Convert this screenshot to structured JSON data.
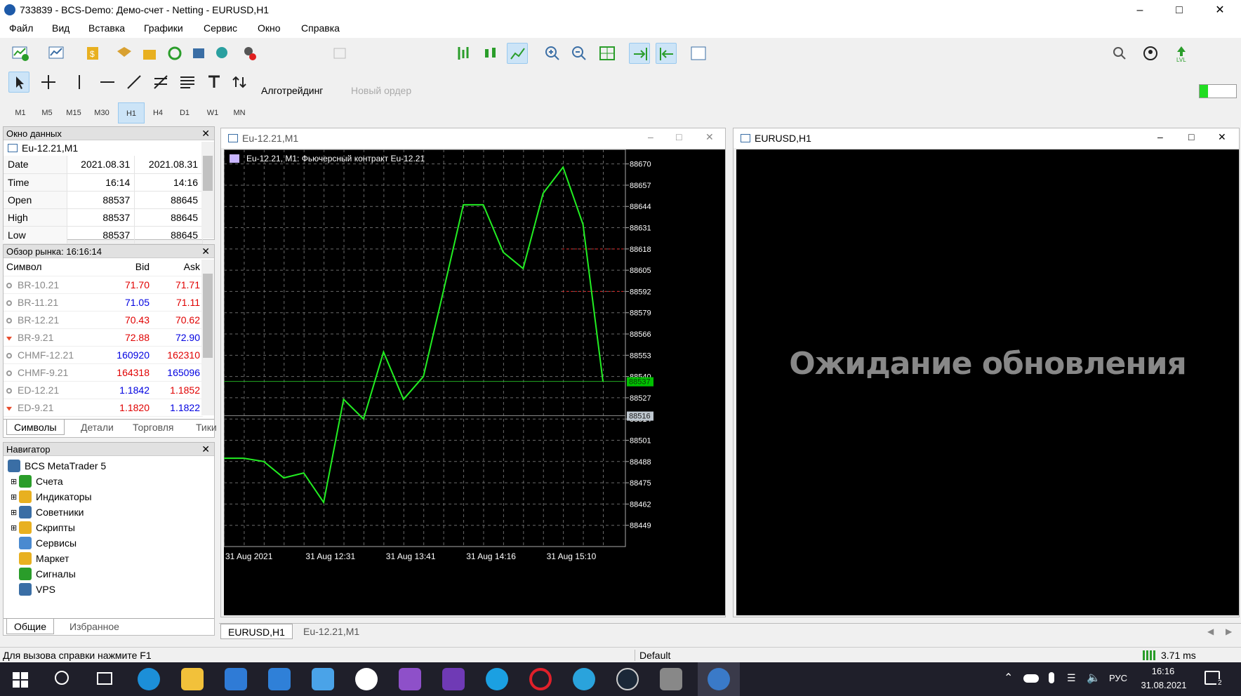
{
  "window": {
    "title": "733839 - BCS-Demo: Демо-счет - Netting - EURUSD,H1"
  },
  "menu": [
    "Файл",
    "Вид",
    "Вставка",
    "Графики",
    "Сервис",
    "Окно",
    "Справка"
  ],
  "toolbar": {
    "algo_label": "Алготрейдинг",
    "new_order_label": "Новый ордер"
  },
  "timeframes": [
    "M1",
    "M5",
    "M15",
    "M30",
    "H1",
    "H4",
    "D1",
    "W1",
    "MN"
  ],
  "timeframe_selected": "H1",
  "data_window": {
    "title": "Окно данных",
    "symbol": "Eu-12.21,M1",
    "rows": [
      {
        "label": "Date",
        "v1": "2021.08.31",
        "v2": "2021.08.31"
      },
      {
        "label": "Time",
        "v1": "16:14",
        "v2": "14:16"
      },
      {
        "label": "Open",
        "v1": "88537",
        "v2": "88645"
      },
      {
        "label": "High",
        "v1": "88537",
        "v2": "88645"
      },
      {
        "label": "Low",
        "v1": "88537",
        "v2": "88645"
      }
    ]
  },
  "market_watch": {
    "title": "Обзор рынка: 16:16:14",
    "headers": {
      "symbol": "Символ",
      "bid": "Bid",
      "ask": "Ask"
    },
    "rows": [
      {
        "symbol": "BR-10.21",
        "bid": "71.70",
        "ask": "71.71",
        "bidc": "red",
        "askc": "red",
        "ico": "dot"
      },
      {
        "symbol": "BR-11.21",
        "bid": "71.05",
        "ask": "71.11",
        "bidc": "blue",
        "askc": "red",
        "ico": "dot"
      },
      {
        "symbol": "BR-12.21",
        "bid": "70.43",
        "ask": "70.62",
        "bidc": "red",
        "askc": "red",
        "ico": "dot"
      },
      {
        "symbol": "BR-9.21",
        "bid": "72.88",
        "ask": "72.90",
        "bidc": "red",
        "askc": "blue",
        "ico": "arrow"
      },
      {
        "symbol": "CHMF-12.21",
        "bid": "160920",
        "ask": "162310",
        "bidc": "blue",
        "askc": "red",
        "ico": "dot"
      },
      {
        "symbol": "CHMF-9.21",
        "bid": "164318",
        "ask": "165096",
        "bidc": "red",
        "askc": "blue",
        "ico": "dot"
      },
      {
        "symbol": "ED-12.21",
        "bid": "1.1842",
        "ask": "1.1852",
        "bidc": "blue",
        "askc": "red",
        "ico": "dot"
      },
      {
        "symbol": "ED-9.21",
        "bid": "1.1820",
        "ask": "1.1822",
        "bidc": "red",
        "askc": "blue",
        "ico": "arrow"
      }
    ],
    "tabs": [
      "Символы",
      "Детали",
      "Торговля",
      "Тики"
    ]
  },
  "navigator": {
    "title": "Навигатор",
    "root": "BCS MetaTrader 5",
    "items": [
      "Счета",
      "Индикаторы",
      "Советники",
      "Скрипты",
      "Сервисы",
      "Маркет",
      "Сигналы",
      "VPS"
    ],
    "tabs": [
      "Общие",
      "Избранное"
    ]
  },
  "chart1": {
    "window_title": "Eu-12.21,M1",
    "header": "Eu-12.21, M1:  Фьючерсный контракт Eu-12.21",
    "price_label": "88537",
    "price_label2": "88516"
  },
  "chart2": {
    "window_title": "EURUSD,H1",
    "message": "Ожидание обновления"
  },
  "chart_tabs": [
    "EURUSD,H1",
    "Eu-12.21,M1"
  ],
  "status": {
    "help": "Для вызова справки нажмите F1",
    "profile": "Default",
    "ping": "3.71 ms"
  },
  "taskbar": {
    "time": "16:16",
    "date": "31.08.2021",
    "lang": "РУС",
    "notif": "2"
  },
  "colors": {
    "line": "#22ee22",
    "chart_bg": "#000000",
    "grid": "#6a6a6a",
    "price_bg": "#00c000"
  },
  "chart_data": {
    "type": "line",
    "title": "",
    "xlabel": "",
    "ylabel": "",
    "ylim": [
      88436,
      88678
    ],
    "y_ticks": [
      88670,
      88657,
      88644,
      88631,
      88618,
      88605,
      88592,
      88579,
      88566,
      88553,
      88540,
      88527,
      88514,
      88501,
      88488,
      88475,
      88462,
      88449
    ],
    "x_tick_labels": [
      "31 Aug 2021",
      "31 Aug 12:31",
      "31 Aug 13:41",
      "31 Aug 14:16",
      "31 Aug 15:10"
    ],
    "x_count": 20,
    "series": [
      {
        "values": [
          88490,
          88490,
          88488,
          88478,
          88481,
          88463,
          88526,
          88514,
          88555,
          88526,
          88540,
          88592,
          88645,
          88645,
          88616,
          88606,
          88652,
          88668,
          88633,
          88537
        ]
      }
    ]
  }
}
